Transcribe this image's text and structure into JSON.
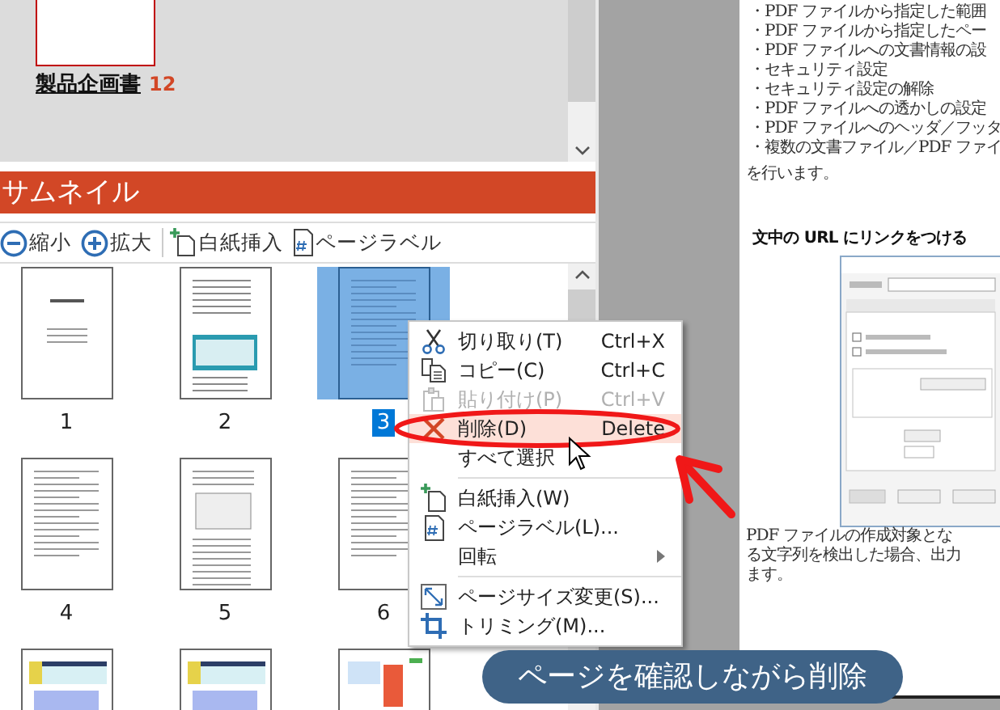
{
  "top_document": {
    "title": "製品企画書",
    "page_count": "12"
  },
  "thumbnail_panel": {
    "title": "サムネイル",
    "toolbar": [
      {
        "kind": "zoom-out",
        "label": "縮小"
      },
      {
        "kind": "zoom-in",
        "label": "拡大"
      },
      {
        "kind": "insert-blank",
        "label": "白紙挿入"
      },
      {
        "kind": "page-label",
        "label": "ページラベル"
      }
    ],
    "pages": [
      {
        "kind": "cover",
        "label": "1",
        "selected": false
      },
      {
        "kind": "screenshot",
        "label": "2",
        "selected": false
      },
      {
        "kind": "text",
        "label": "3",
        "selected": true
      },
      {
        "kind": "text",
        "label": "4",
        "selected": false
      },
      {
        "kind": "dialog",
        "label": "5",
        "selected": false
      },
      {
        "kind": "text",
        "label": "6",
        "selected": false
      },
      {
        "kind": "spreadsheet",
        "selected": false
      },
      {
        "kind": "spreadsheet",
        "selected": false
      },
      {
        "kind": "flyer",
        "selected": false
      }
    ]
  },
  "context_menu": [
    {
      "kind": "cut",
      "label": "切り取り(T)",
      "shortcut": "Ctrl+X",
      "disabled": false,
      "selected": false
    },
    {
      "kind": "copy",
      "label": "コピー(C)",
      "shortcut": "Ctrl+C",
      "disabled": false,
      "selected": false
    },
    {
      "kind": "paste",
      "label": "貼り付け(P)",
      "shortcut": "Ctrl+V",
      "disabled": true,
      "selected": false
    },
    {
      "kind": "delete",
      "label": "削除(D)",
      "shortcut": "Delete",
      "disabled": false,
      "selected": true
    },
    {
      "kind": "plain",
      "label": "すべて選択",
      "disabled": false,
      "selected": false
    },
    {
      "kind": "separator"
    },
    {
      "kind": "insert-blank",
      "label": "白紙挿入(W)",
      "disabled": false,
      "selected": false
    },
    {
      "kind": "page-label",
      "label": "ページラベル(L)...",
      "disabled": false,
      "selected": false
    },
    {
      "kind": "submenu",
      "label": "回転",
      "disabled": false,
      "selected": false
    },
    {
      "kind": "separator"
    },
    {
      "kind": "page-size",
      "label": "ページサイズ変更(S)...",
      "disabled": false,
      "selected": false
    },
    {
      "kind": "trim",
      "label": "トリミング(M)...",
      "disabled": false,
      "selected": false
    }
  ],
  "document": {
    "bullets": [
      "・PDF ファイルから指定した範囲",
      "・PDF ファイルから指定したペー",
      "・PDF ファイルへの文書情報の設",
      "・セキュリティ設定",
      "・セキュリティ設定の解除",
      "・PDF ファイルへの透かしの設定",
      "・PDF ファイルへのヘッダ／フッタ",
      "・複数の文書ファイル／PDF ファイ"
    ],
    "after_list": "を行います。",
    "heading": "文中の URL にリンクをつける",
    "paragraph": [
      "PDF ファイルの作成対象とな",
      "る文字列を検出した場合、出力",
      "ます。"
    ]
  },
  "caption": "ページを確認しながら削除"
}
